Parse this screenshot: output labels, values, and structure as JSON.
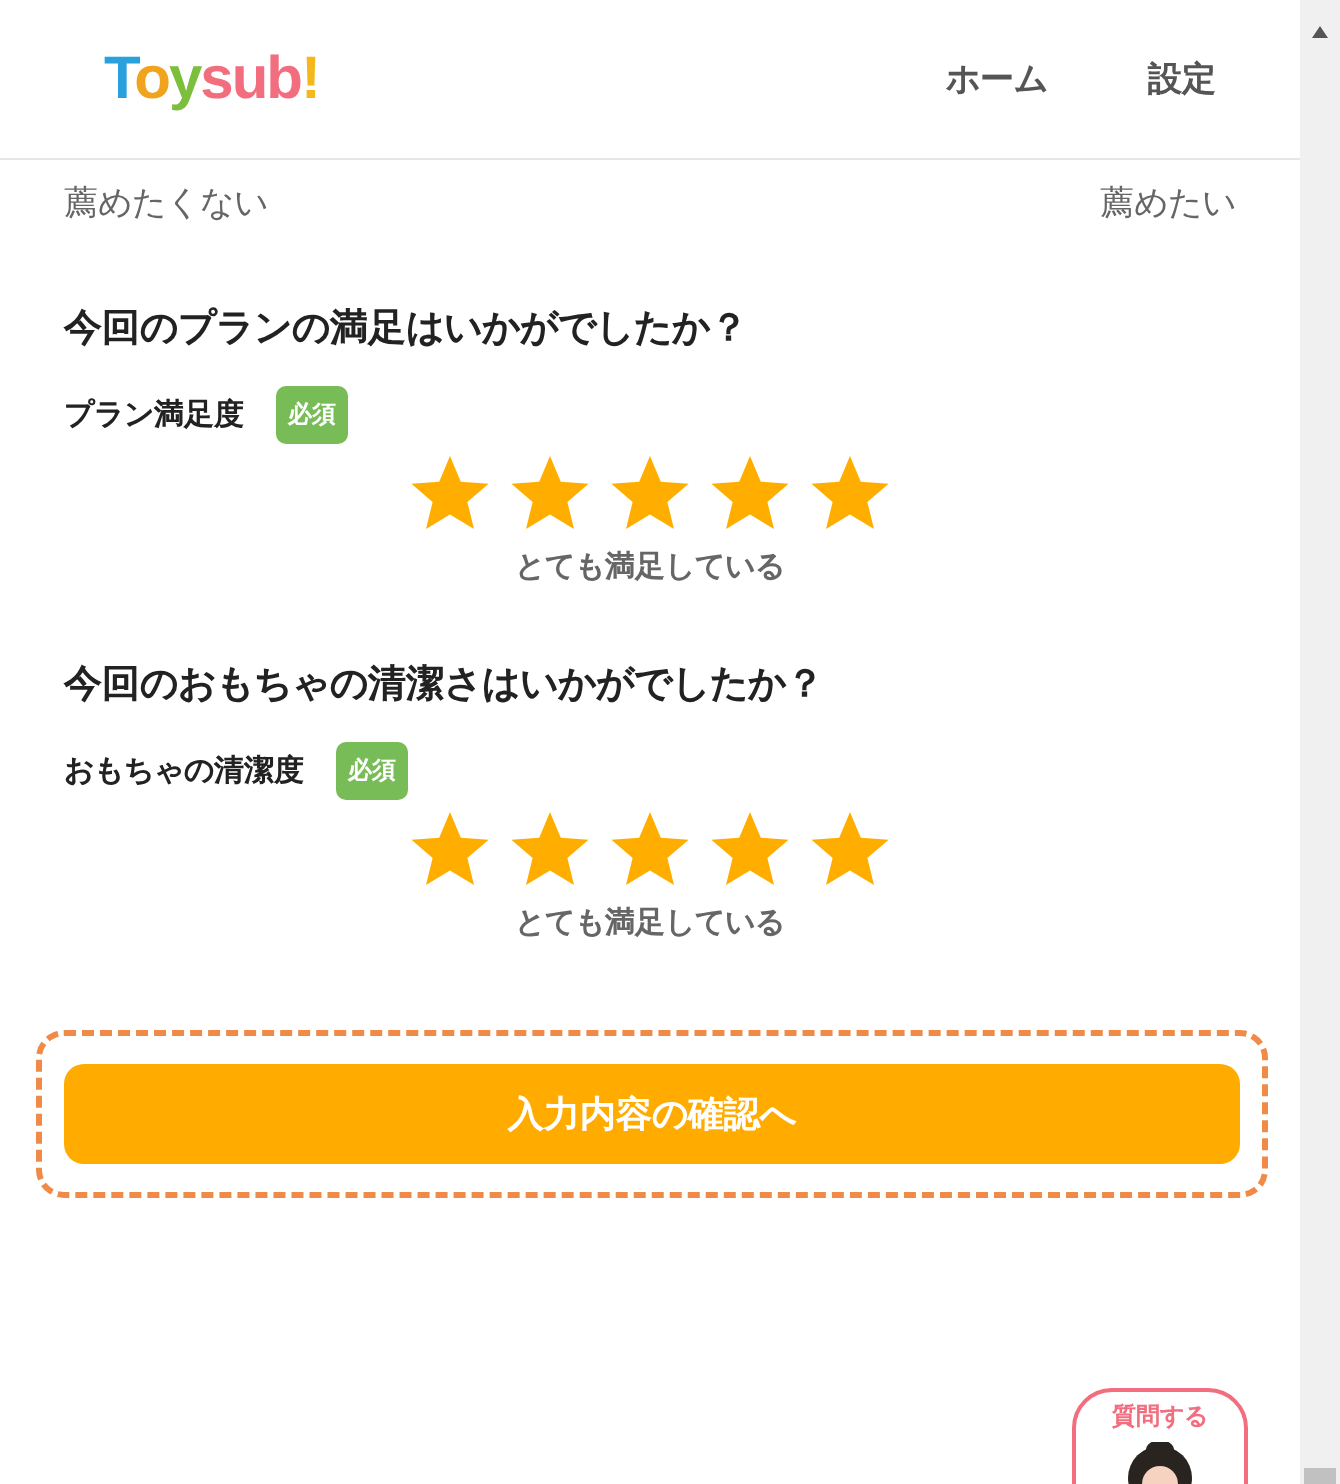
{
  "header": {
    "logo": "Toysub!",
    "nav": [
      {
        "label": "ホーム"
      },
      {
        "label": "設定"
      }
    ]
  },
  "scale": {
    "low_label": "薦めたくない",
    "high_label": "薦めたい"
  },
  "questions": [
    {
      "title": "今回のプランの満足はいかがでしたか？",
      "label": "プラン満足度",
      "badge": "必須",
      "stars": 5,
      "caption": "とても満足している"
    },
    {
      "title": "今回のおもちゃの清潔さはいかがでしたか？",
      "label": "おもちゃの清潔度",
      "badge": "必須",
      "stars": 5,
      "caption": "とても満足している"
    }
  ],
  "submit_button": "入力内容の確認へ",
  "help_button": "質問する"
}
